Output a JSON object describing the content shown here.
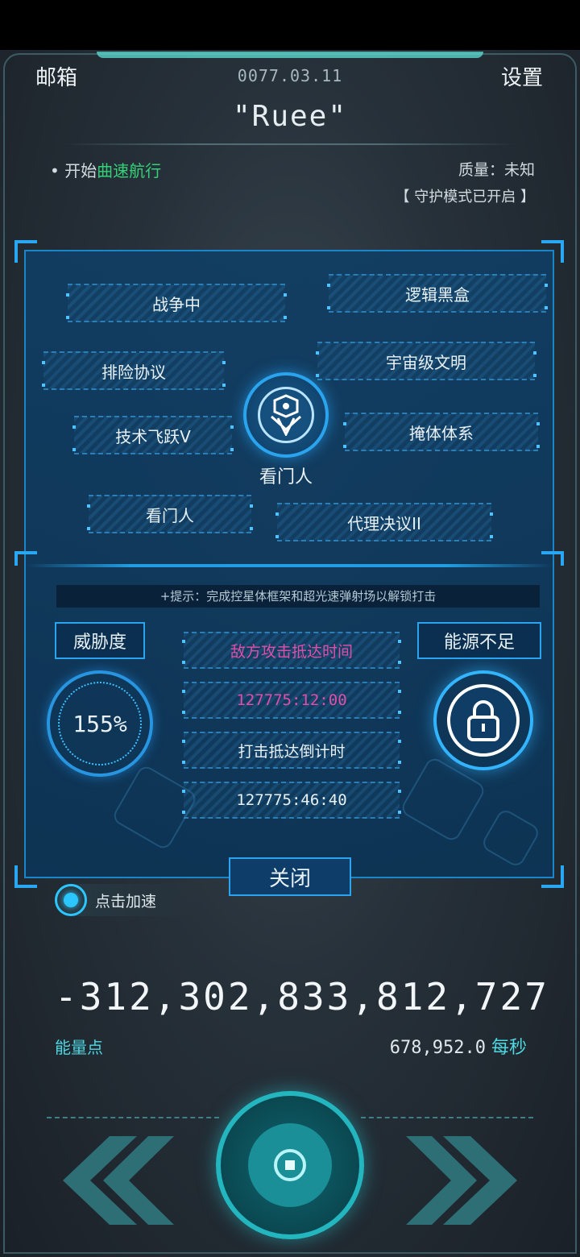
{
  "header": {
    "mailbox_label": "邮箱",
    "date": "0077.03.11",
    "settings_label": "设置",
    "ship_name": "\"Ruee\""
  },
  "status": {
    "warp_prefix": "• 开始",
    "warp_highlight": "曲速航行",
    "mass": "质量：未知",
    "guard_mode": "【 守护模式已开启 】"
  },
  "panel": {
    "techs": [
      "战争中",
      "逻辑黑盒",
      "排险协议",
      "宇宙级文明",
      "技术飞跃V",
      "掩体体系",
      "看门人",
      "代理决议II"
    ],
    "emblem_label": "看门人",
    "hint": "+提示：完成控星体框架和超光速弹射场以解锁打击",
    "threat_label": "威胁度",
    "threat_value": "155%",
    "energy_low_label": "能源不足",
    "arrival_time_label": "敌方攻击抵达时间",
    "arrival_time_value": "127775:12:00",
    "strike_countdown_label": "打击抵达倒计时",
    "strike_countdown_value": "127775:46:40",
    "close_label": "关闭"
  },
  "accelerate_label": "点击加速",
  "energy": {
    "value": "-312,302,833,812,727",
    "label": "能量点",
    "rate": "678,952.0",
    "rate_unit": "每秒"
  },
  "colors": {
    "accent_blue": "#2aa4ee",
    "accent_teal": "#23b6bf",
    "warp_green": "#35d178",
    "alert_magenta": "#e04ea8"
  },
  "icons": [
    "emblem-icon",
    "lock-icon",
    "accelerate-icon",
    "left-arrows-icon",
    "right-arrows-icon",
    "main-button-icon"
  ]
}
